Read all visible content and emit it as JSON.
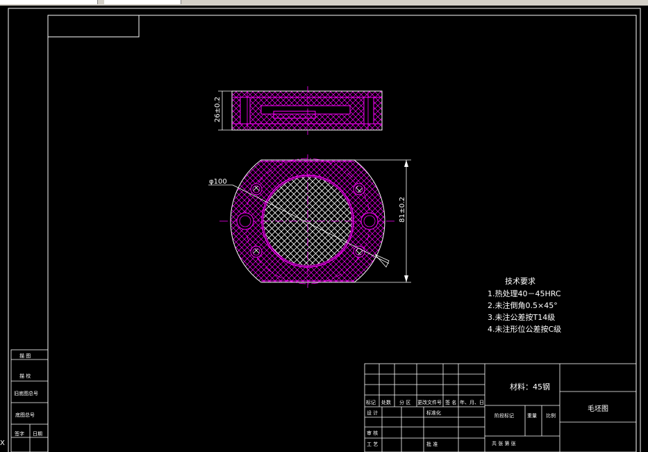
{
  "drawing": {
    "dimensions": {
      "thickness": "26±0.2",
      "diameter": "φ100",
      "width": "81±0.2"
    },
    "technical_requirements": {
      "title": "技术要求",
      "items": [
        "1.热处理40－45HRC",
        "2.未注倒角0.5×45°",
        "3.未注公差按T14级",
        "4.未注形位公差按C级"
      ]
    }
  },
  "left_block": {
    "rows": [
      "描  图",
      "描  校",
      "旧底图总号",
      "底图总号",
      "签字",
      "日期"
    ]
  },
  "title_block": {
    "material": "材料：45钢",
    "drawing_name": "毛坯图",
    "revision_headers": [
      "标记",
      "处数",
      "分  区",
      "更改文件号",
      "签  名",
      "年、月、日"
    ],
    "design": "设  计",
    "standardization": "标准化",
    "review": "审  核",
    "process": "工  艺",
    "approve": "批  准",
    "stage_mark": "阶段标记",
    "weight": "重量",
    "scale": "比例",
    "sheets": "共    张  第    张"
  },
  "colors": {
    "background": "#000000",
    "lines": "#ffffff",
    "section": "#ff00ff",
    "hatch": "#ffffff"
  }
}
